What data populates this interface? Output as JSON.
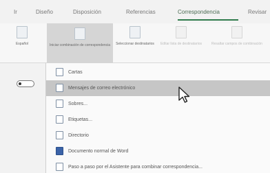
{
  "tabs": [
    "Ir",
    "Diseño",
    "Disposición",
    "Referencias",
    "Correspondencia",
    "Revisar"
  ],
  "active_tab_index": 4,
  "ribbon": {
    "buttons": [
      {
        "label": "Español"
      },
      {
        "label": "Iniciar combinación de correspondencia"
      },
      {
        "label": "Seleccionar destinatarios"
      },
      {
        "label": "Editar lista de destinatarios"
      },
      {
        "label": "Resaltar campos de combinación"
      }
    ]
  },
  "menu": {
    "items": [
      {
        "label": "Cartas",
        "icon": "letter-icon"
      },
      {
        "label": "Mensajes de correo electrónico",
        "icon": "email-message-icon"
      },
      {
        "label": "Sobres...",
        "icon": "envelope-icon"
      },
      {
        "label": "Etiquetas...",
        "icon": "label-icon"
      },
      {
        "label": "Directorio",
        "icon": "directory-icon"
      },
      {
        "label": "Documento normal de Word",
        "icon": "word-document-icon"
      },
      {
        "label": "Paso a paso por el Asistente para combinar correspondencia...",
        "icon": "wizard-icon"
      }
    ],
    "hover_index": 1
  }
}
